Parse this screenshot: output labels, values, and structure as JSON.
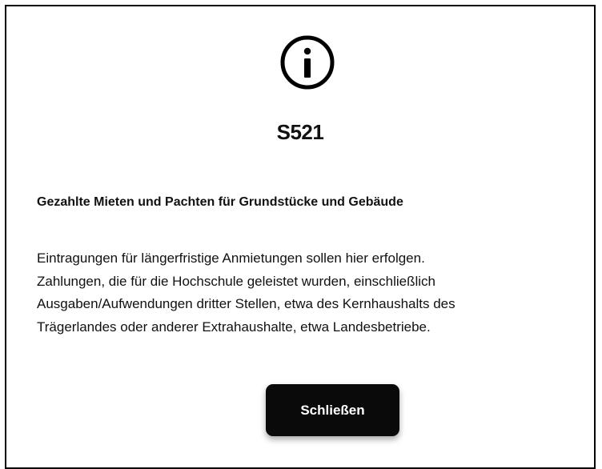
{
  "dialog": {
    "icon": "info-icon",
    "code": "S521",
    "heading": "Gezahlte Mieten und Pachten für Grundstücke und Gebäude",
    "body_lines": [
      "Eintragungen für längerfristige Anmietungen sollen hier erfolgen.",
      "Zahlungen, die für die Hochschule geleistet wurden, einschließlich",
      "Ausgaben/Aufwendungen dritter Stellen, etwa des Kernhaushalts des",
      "Trägerlandes oder anderer Extrahaushalte, etwa Landesbetriebe."
    ],
    "close_label": "Schließen"
  },
  "colors": {
    "button_background": "#0a0a0a",
    "button_text": "#ffffff",
    "border": "#000000"
  }
}
